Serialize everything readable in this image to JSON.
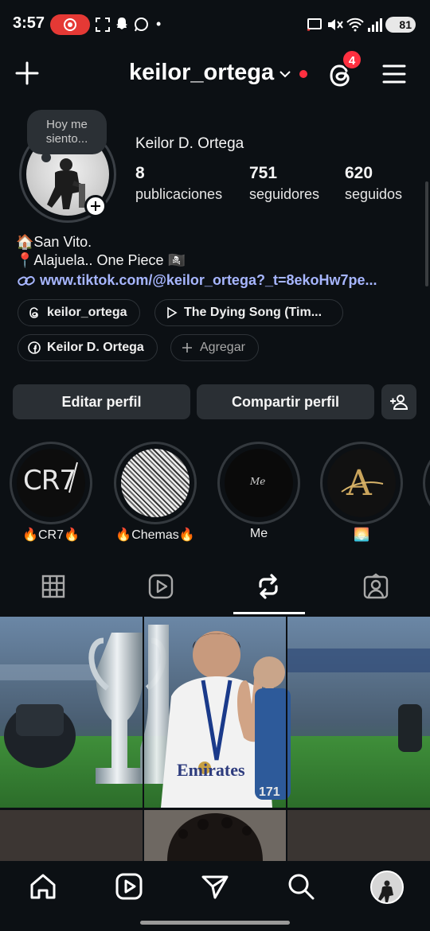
{
  "status_bar": {
    "time": "3:57",
    "battery": "81",
    "dot": "•"
  },
  "header": {
    "username": "keilor_ortega",
    "threads_badge": "4"
  },
  "profile": {
    "note": "Hoy me siento...",
    "full_name": "Keilor D. Ortega",
    "stats": [
      {
        "value": "8",
        "label": "publicaciones"
      },
      {
        "value": "751",
        "label": "seguidores"
      },
      {
        "value": "620",
        "label": "seguidos"
      }
    ],
    "bio_lines": [
      "🏠San Vito.",
      "📍Alajuela.. One Piece 🏴‍☠️"
    ],
    "link": "www.tiktok.com/@keilor_ortega?_t=8ekoHw7pe..."
  },
  "chips": [
    {
      "icon": "threads-icon",
      "label": "keilor_ortega"
    },
    {
      "icon": "play-icon",
      "label": "The Dying Song (Tim..."
    },
    {
      "icon": "facebook-icon",
      "label": "Keilor D. Ortega"
    },
    {
      "icon": "plus-icon",
      "label": "Agregar"
    }
  ],
  "buttons": {
    "edit": "Editar perfil",
    "share": "Compartir perfil"
  },
  "highlights": [
    {
      "label": "🔥CR7🔥",
      "cover_text": "CR7"
    },
    {
      "label": "🔥Chemas🔥",
      "cover_text": ""
    },
    {
      "label": "Me",
      "cover_text": "Me"
    },
    {
      "label": "🌅",
      "cover_text": "A"
    }
  ],
  "tabs": [
    "grid-icon",
    "reels-icon",
    "reposts-icon",
    "tagged-icon"
  ],
  "active_tab": "reposts-icon",
  "post": {
    "jersey_text": "Emirates",
    "number": "171"
  },
  "bottom_nav": [
    "home-icon",
    "reels-icon",
    "send-icon",
    "search-icon",
    "profile-avatar"
  ]
}
